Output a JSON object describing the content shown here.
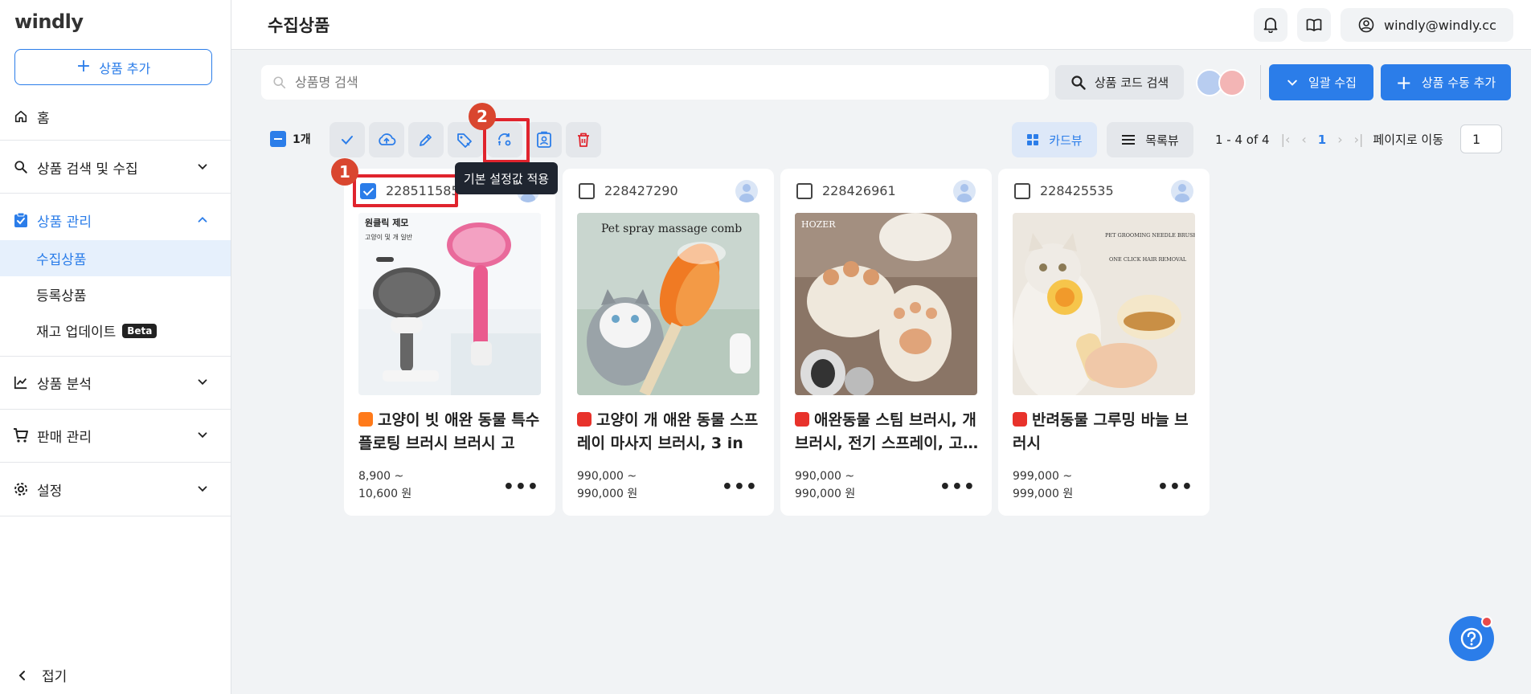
{
  "app": {
    "logo": "windly"
  },
  "sidebar": {
    "add_button": "상품 추가",
    "items": [
      {
        "label": "홈",
        "icon": "home-icon"
      },
      {
        "label": "상품 검색 및 수집",
        "icon": "search-icon"
      },
      {
        "label": "상품 관리",
        "icon": "clipboard-check-icon",
        "active": true,
        "sub": [
          {
            "label": "수집상품",
            "selected": true
          },
          {
            "label": "등록상품"
          },
          {
            "label": "재고 업데이트",
            "badge": "Beta"
          }
        ]
      },
      {
        "label": "상품 분석",
        "icon": "chart-icon"
      },
      {
        "label": "판매 관리",
        "icon": "cart-icon"
      },
      {
        "label": "설정",
        "icon": "gear-icon"
      }
    ],
    "collapse_label": "접기"
  },
  "header": {
    "title": "수집상품",
    "account": "windly@windly.cc"
  },
  "search": {
    "placeholder": "상품명 검색",
    "code_search_label": "상품 코드 검색"
  },
  "actions": {
    "bulk_collect": "일괄 수집",
    "manual_add": "상품 수동 추가"
  },
  "toolbar": {
    "selected_count": "1개",
    "tooltip": "기본 설정값 적용",
    "card_view": "카드뷰",
    "list_view": "목록뷰",
    "range": "1 - 4 of 4",
    "current_page": "1",
    "goto_label": "페이지로 이동",
    "goto_value": "1"
  },
  "annotations": {
    "step1": "1",
    "step2": "2"
  },
  "colors": {
    "accent": "#2b7de9",
    "highlight": "#e0242d",
    "badge": "#d9462f"
  },
  "products": [
    {
      "id": "228511585",
      "checked": true,
      "marketplace": "taobao",
      "title": "고양이 빗 애완 동물 특수 플로팅 브러시 브러시 고양…",
      "price_line1": "8,900 ~",
      "price_line2": "10,600 원",
      "image_text1": "원클릭 제모",
      "image_text2": "고양이 및 개 일반"
    },
    {
      "id": "228427290",
      "checked": false,
      "marketplace": "aliexpress",
      "title": "고양이 개 애완 동물 스프레이 마사지 브러시, 3 in 1…",
      "price_line1": "990,000 ~",
      "price_line2": "990,000 원",
      "image_text1": "Pet spray massage comb"
    },
    {
      "id": "228426961",
      "checked": false,
      "marketplace": "aliexpress",
      "title": "애완동물 스팀 브러시, 개 브러시, 전기 스프레이, 고…",
      "price_line1": "990,000 ~",
      "price_line2": "990,000 원",
      "image_text1": "HOZER"
    },
    {
      "id": "228425535",
      "checked": false,
      "marketplace": "aliexpress",
      "title": "반려동물 그루밍 바늘 브러시",
      "price_line1": "999,000 ~",
      "price_line2": "999,000 원",
      "image_text1": "PET GROOMING NEEDLE BRUSH",
      "image_text2": "ONE CLICK HAIR REMOVAL"
    }
  ]
}
